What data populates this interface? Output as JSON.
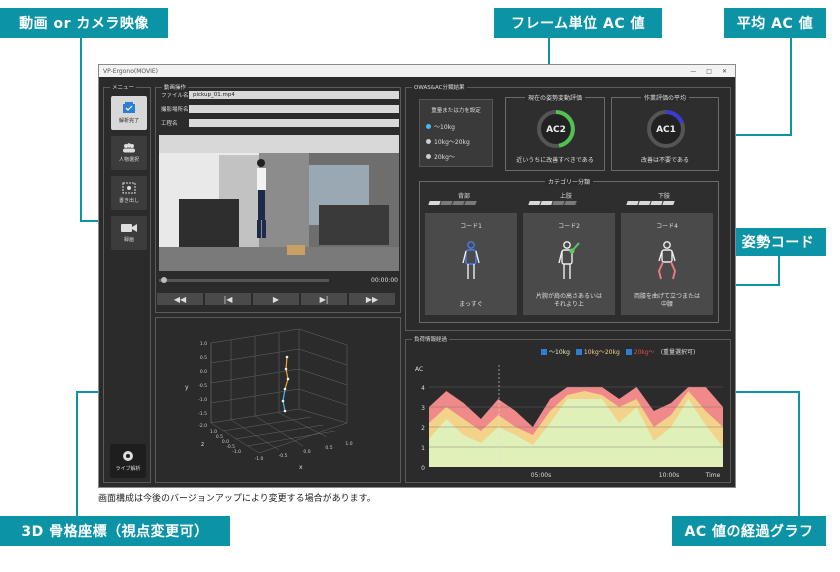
{
  "callouts": {
    "video": "動画 or カメラ映像",
    "frame_ac": "フレーム単位 AC 値",
    "avg_ac": "平均 AC 値",
    "posture_code": "姿勢コード",
    "skeleton": "3D 骨格座標（視点変更可）",
    "ac_graph": "AC 値の経過グラフ"
  },
  "window": {
    "title": "VP-Ergono(MOVIE)",
    "buttons": [
      "—",
      "□",
      "✕"
    ]
  },
  "menu": {
    "title": "メニュー",
    "items": [
      {
        "label": "解析完了",
        "icon": "checklist-icon"
      },
      {
        "label": "人物選択",
        "icon": "people-icon"
      },
      {
        "label": "書き出し",
        "icon": "export-icon"
      },
      {
        "label": "録画",
        "icon": "camera-icon"
      }
    ],
    "live": "ライブ解析"
  },
  "video": {
    "panel_title": "動画操作",
    "file_label": "ファイル名",
    "file_value": "pickup_01.mp4",
    "location_label": "撮影場所名",
    "process_label": "工程名",
    "time": "00:00:00",
    "controls": [
      "◀◀",
      "|◀",
      "▶",
      "▶|",
      "▶▶"
    ]
  },
  "skeleton": {
    "axis_y": "y",
    "axis_z": "z",
    "axis_x": "x",
    "y_ticks": [
      "1.0",
      "0.5",
      "0.0",
      "-0.5",
      "-1.0",
      "-1.5",
      "-2.0"
    ],
    "z_ticks": [
      "1.0",
      "0.5",
      "0.0",
      "-0.5",
      "-1.0"
    ],
    "x_ticks": [
      "-1.0",
      "-0.5",
      "0.0",
      "0.5",
      "1.0"
    ]
  },
  "owas": {
    "panel_title": "OWAS&AC分類結果",
    "load_title": "重量または力を設定",
    "load_options": [
      "〜10kg",
      "10kg〜20kg",
      "20kg〜"
    ],
    "current_title": "現在の姿勢変動評価",
    "current_value": "AC2",
    "current_desc": "近いうちに改善すべきである",
    "avg_title": "作業評価の平均",
    "avg_value": "AC1",
    "avg_desc": "改善は不要である",
    "category_title": "カテゴリー分類",
    "cards": [
      {
        "part": "背部",
        "code": "コード1",
        "desc1": "まっすぐ",
        "desc2": ""
      },
      {
        "part": "上肢",
        "code": "コード2",
        "desc1": "片腕が肩の高さあるいは",
        "desc2": "それより上"
      },
      {
        "part": "下肢",
        "code": "コード4",
        "desc1": "両膝を曲げて立つまたは",
        "desc2": "中腰"
      }
    ]
  },
  "colors": {
    "accent": "#0d93a6",
    "ring_ac2": "#4fc24f",
    "ring_ac1": "#3a3ad8",
    "area_light": "#dff0b8",
    "area_yellow": "#f3d28a",
    "area_red": "#f08a8a",
    "legend_red": "#e84a4a"
  },
  "graph": {
    "panel_title": "負荷情報経過",
    "legend": [
      "〜10kg",
      "10kg〜20kg",
      "20kg〜",
      "(重量選択可)"
    ],
    "y_label": "AC",
    "y_ticks": [
      "4",
      "3",
      "2",
      "1",
      "0"
    ],
    "x_ticks": [
      "05:00s",
      "10:00s"
    ],
    "x_label": "Time"
  },
  "chart_data": {
    "type": "area",
    "xlabel": "Time",
    "ylabel": "AC",
    "ylim": [
      0,
      4
    ],
    "x": [
      0,
      1,
      2,
      3,
      4,
      5,
      6,
      7,
      8,
      9,
      10,
      11,
      12,
      13,
      14,
      15,
      16,
      17
    ],
    "series": [
      {
        "name": "〜10kg",
        "values": [
          1.4,
          2.4,
          1.6,
          1.2,
          2.0,
          1.6,
          1.1,
          2.2,
          3.4,
          3.4,
          3.4,
          2.2,
          3.0,
          1.3,
          2.0,
          3.4,
          2.1,
          1.0
        ]
      },
      {
        "name": "10kg〜20kg",
        "values": [
          2.2,
          3.0,
          2.4,
          1.8,
          2.6,
          2.0,
          1.6,
          2.8,
          3.6,
          3.8,
          3.6,
          3.0,
          3.4,
          2.0,
          2.6,
          3.8,
          2.8,
          2.0
        ]
      },
      {
        "name": "20kg〜",
        "values": [
          3.0,
          3.8,
          3.2,
          2.4,
          3.4,
          2.8,
          2.0,
          3.4,
          4.0,
          4.0,
          4.0,
          3.4,
          4.0,
          2.8,
          3.2,
          4.0,
          4.0,
          3.0
        ]
      }
    ]
  },
  "footer_note": "画面構成は今後のバージョンアップにより変更する場合があります。"
}
